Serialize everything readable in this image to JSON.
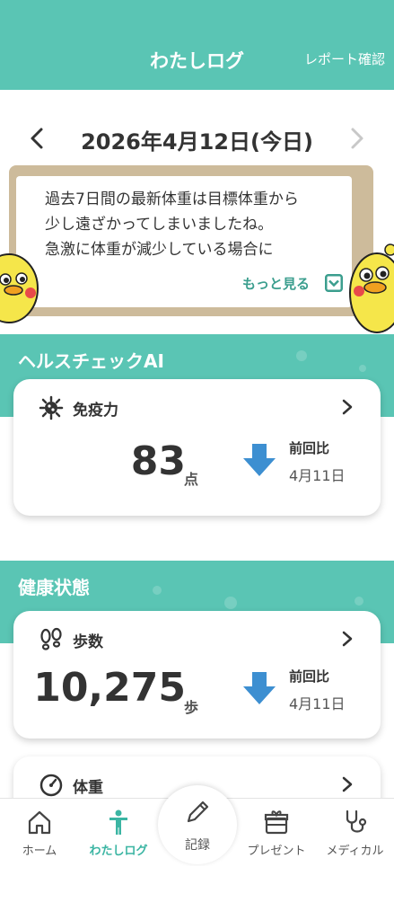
{
  "header": {
    "title": "わたしログ",
    "report_link": "レポート確認"
  },
  "date_nav": {
    "date": "2026年4月12日(今日)",
    "prev_icon": "chevron-left-icon",
    "next_icon": "chevron-right-icon"
  },
  "message_board": {
    "lines": [
      "過去7日間の最新体重は目標体重から",
      "少し遠ざかってしまいましたね。",
      "急激に体重が減少している場合に"
    ],
    "more_label": "もっと見る"
  },
  "health_check": {
    "section_title": "ヘルスチェックAI",
    "card": {
      "title": "免疫力",
      "value": "83",
      "unit": "点",
      "compare_label": "前回比",
      "compare_date": "4月11日",
      "trend": "down"
    }
  },
  "health_status": {
    "section_title": "健康状態",
    "steps_card": {
      "title": "歩数",
      "value": "10,275",
      "unit": "歩",
      "compare_label": "前回比",
      "compare_date": "4月11日",
      "trend": "down"
    },
    "weight_card": {
      "title": "体重"
    }
  },
  "bottom_nav": {
    "items": [
      {
        "label": "ホーム",
        "icon": "home-icon"
      },
      {
        "label": "わたしログ",
        "icon": "person-icon",
        "active": true
      },
      {
        "label": "記録",
        "icon": "pencil-icon"
      },
      {
        "label": "プレゼント",
        "icon": "gift-icon"
      },
      {
        "label": "メディカル",
        "icon": "stethoscope-icon"
      }
    ]
  },
  "colors": {
    "accent": "#5ac5b4",
    "arrow": "#3d8fd1",
    "board": "#cdbb9b"
  }
}
